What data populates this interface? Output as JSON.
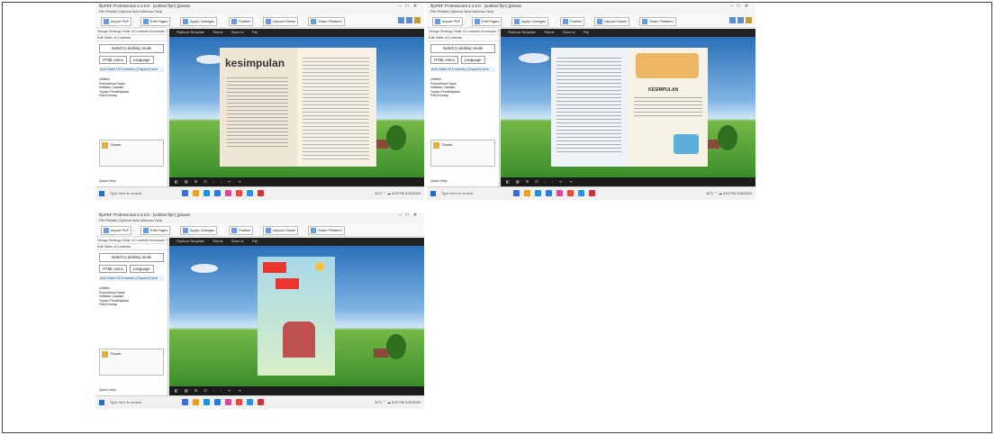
{
  "app": {
    "title": "flipPDF Professional 2.4.9.8 - [untitled flip*] [please",
    "menu": "File  Publish  Options  View  Window  Help",
    "toolbar": [
      "Import PDF",
      "Edit Pages",
      "Apply Changes",
      "Publish",
      "Upload Online",
      "Share Platform"
    ],
    "left_tabs": "Design Settings  Table of Contents  Bookmark Tool",
    "edit_label": "Edit Table of Contents",
    "switch_label": "Switch to desktop mode",
    "toc_buttons": [
      "HTML menu",
      "Language"
    ],
    "add_toc": "Add Table Of Contents (Chapter) here",
    "tree_label": "Untitled",
    "tree": [
      "Kompetensi Dasar",
      "Indikator Capaian",
      "Tujuan Pembelajaran",
      "Peta Konsep"
    ],
    "thumb_label": "Thumb",
    "help_label": "Quick Help",
    "viewer_items": [
      "Flipbook Template",
      "Theme",
      "Zoom In",
      "Thumbnails",
      "Flip",
      "Print",
      "Sound"
    ],
    "search_placeholder": "Type here to search",
    "tray_temp": "32°C",
    "tray_time": "3:22 PM",
    "tray_date": "3/15/2023"
  },
  "shots": [
    {
      "page_title": "kesimpulan"
    },
    {
      "page_title": "KESIMPULAN"
    },
    {
      "page_title": ""
    }
  ]
}
